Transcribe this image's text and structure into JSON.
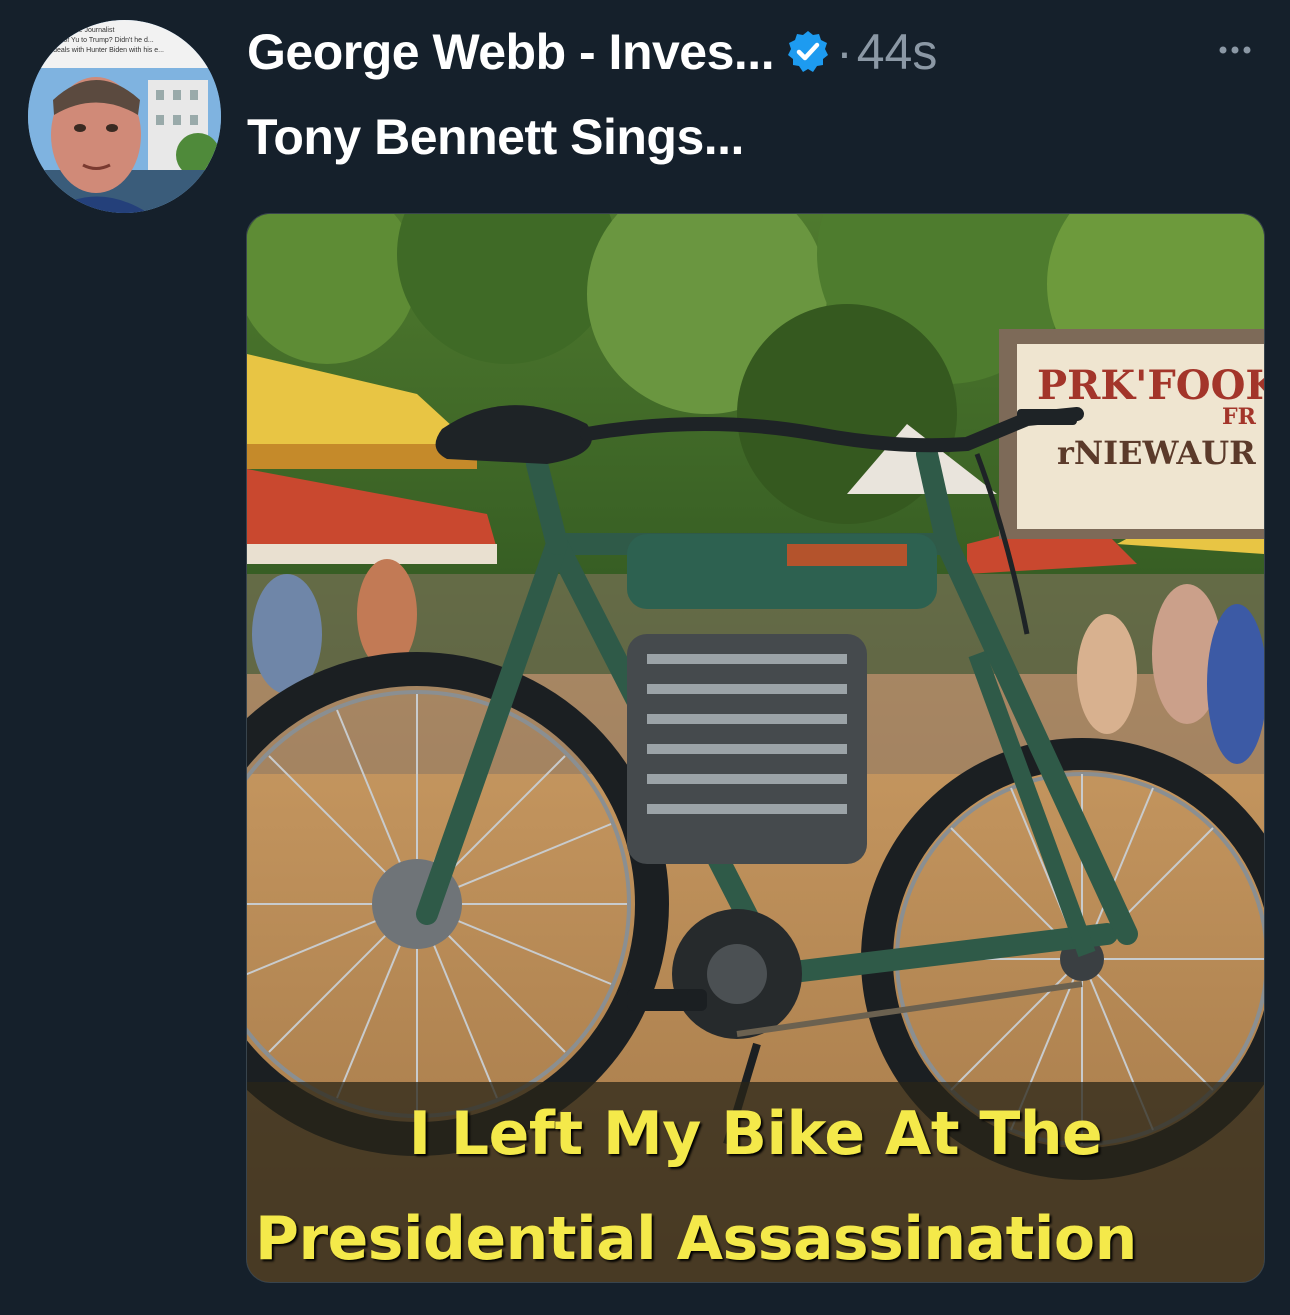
{
  "tweet": {
    "display_name": "George Webb - Inves...",
    "separator": "·",
    "timestamp": "44s",
    "text": "Tony Bennett Sings...",
    "more_icon": "ellipsis-icon",
    "verified_icon": "verified-badge-icon"
  },
  "avatar": {
    "lines": [
      "...gative Journalist",
      "...ome of Yu to Trump? Didn't he d...",
      "...ons deals with Hunter Biden with his e..."
    ]
  },
  "media": {
    "caption_line1": "I Left My Bike At The",
    "caption_line2": "Presidential Assassination",
    "sign_text": "PRK'FOOK",
    "sign_text2": "FR",
    "sign_text3": "rNIEWAUR"
  },
  "colors": {
    "background": "#15202b",
    "secondary_text": "#8b98a5",
    "verified_blue": "#1d9bf0",
    "caption_yellow": "#f4e94a",
    "bike_green": "#2f5a48"
  }
}
